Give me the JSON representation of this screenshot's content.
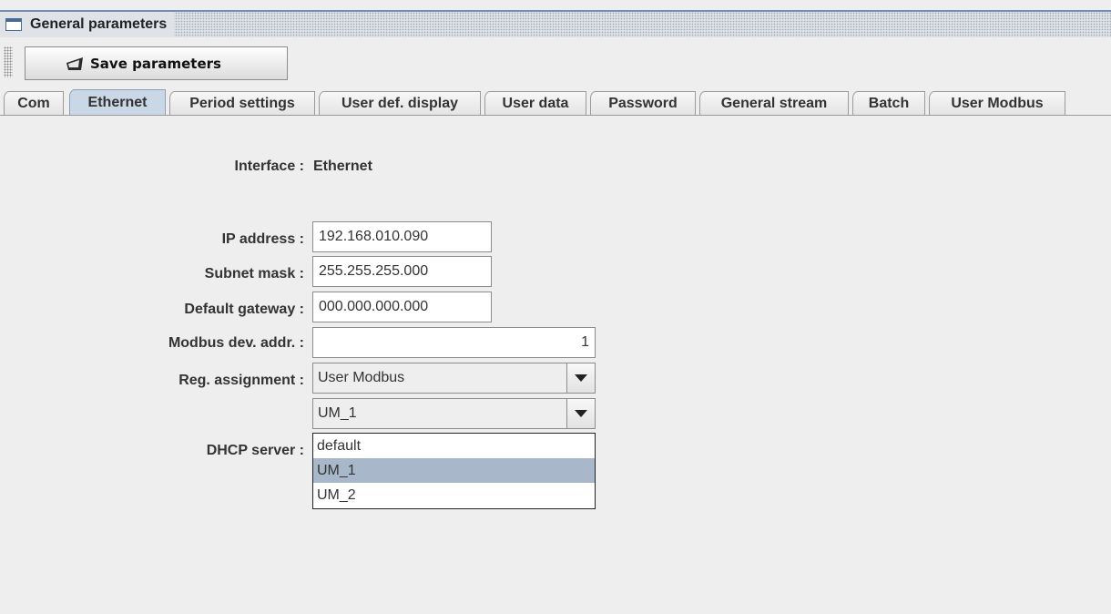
{
  "window": {
    "title": "General parameters"
  },
  "toolbar": {
    "save_label": "Save parameters"
  },
  "tabs": [
    {
      "label": "Com"
    },
    {
      "label": "Ethernet"
    },
    {
      "label": "Period settings"
    },
    {
      "label": "User def. display"
    },
    {
      "label": "User data"
    },
    {
      "label": "Password"
    },
    {
      "label": "General stream"
    },
    {
      "label": "Batch"
    },
    {
      "label": "User Modbus"
    }
  ],
  "active_tab": "Ethernet",
  "form": {
    "interface_label": "Interface :",
    "interface_value": "Ethernet",
    "ip_label": "IP address :",
    "ip_value": "192.168.010.090",
    "subnet_label": "Subnet mask :",
    "subnet_value": "255.255.255.000",
    "gateway_label": "Default gateway :",
    "gateway_value": "000.000.000.000",
    "modbus_label": "Modbus dev. addr. :",
    "modbus_value": "1",
    "reg_label": "Reg. assignment :",
    "reg_value": "User Modbus",
    "um_value": "UM_1",
    "dhcp_label": "DHCP server :"
  },
  "dropdown": {
    "items": [
      "default",
      "UM_1",
      "UM_2"
    ],
    "selected": "UM_1"
  },
  "colors": {
    "active_tab": "#cad7e6",
    "selected_item": "#a8b8ca",
    "title_border": "#6d8fb8"
  }
}
